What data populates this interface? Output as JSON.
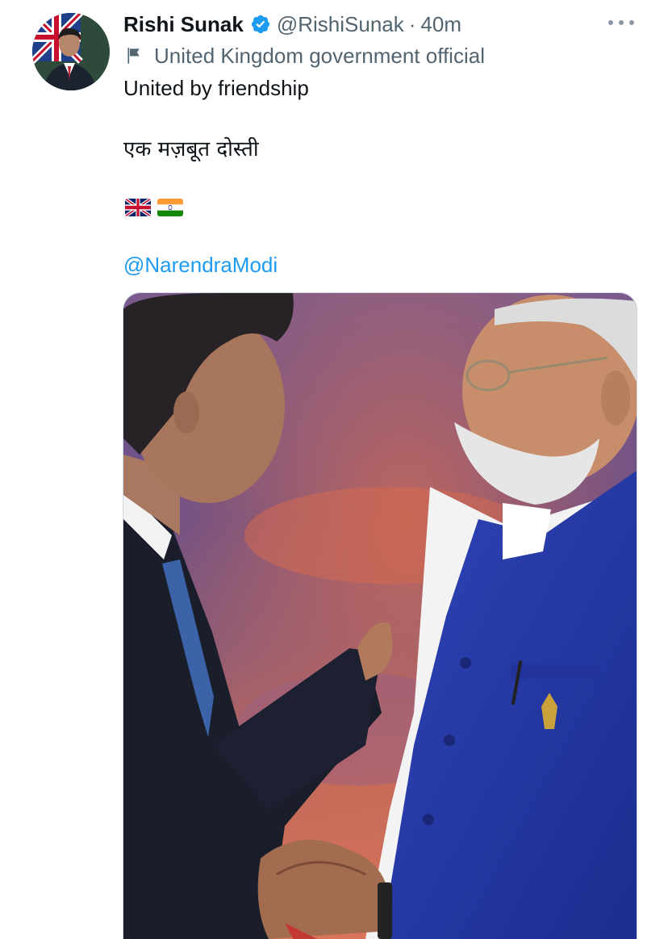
{
  "author": {
    "display_name": "Rishi Sunak",
    "handle": "@RishiSunak",
    "separator": "·",
    "timestamp": "40m",
    "affiliation": "United Kingdom government official",
    "verified": true
  },
  "icons": {
    "verified": "verified-badge-icon",
    "affiliation": "flag-icon",
    "more": "more-options-icon"
  },
  "tweet": {
    "line1": "United by friendship",
    "line2": "एक मज़बूत दोस्ती",
    "emojis": [
      "uk-flag",
      "india-flag"
    ],
    "mention": "@NarendraModi"
  },
  "colors": {
    "text": "#0f1419",
    "secondary": "#536471",
    "link": "#1d9bf0",
    "verified": "#1d9bf0"
  }
}
